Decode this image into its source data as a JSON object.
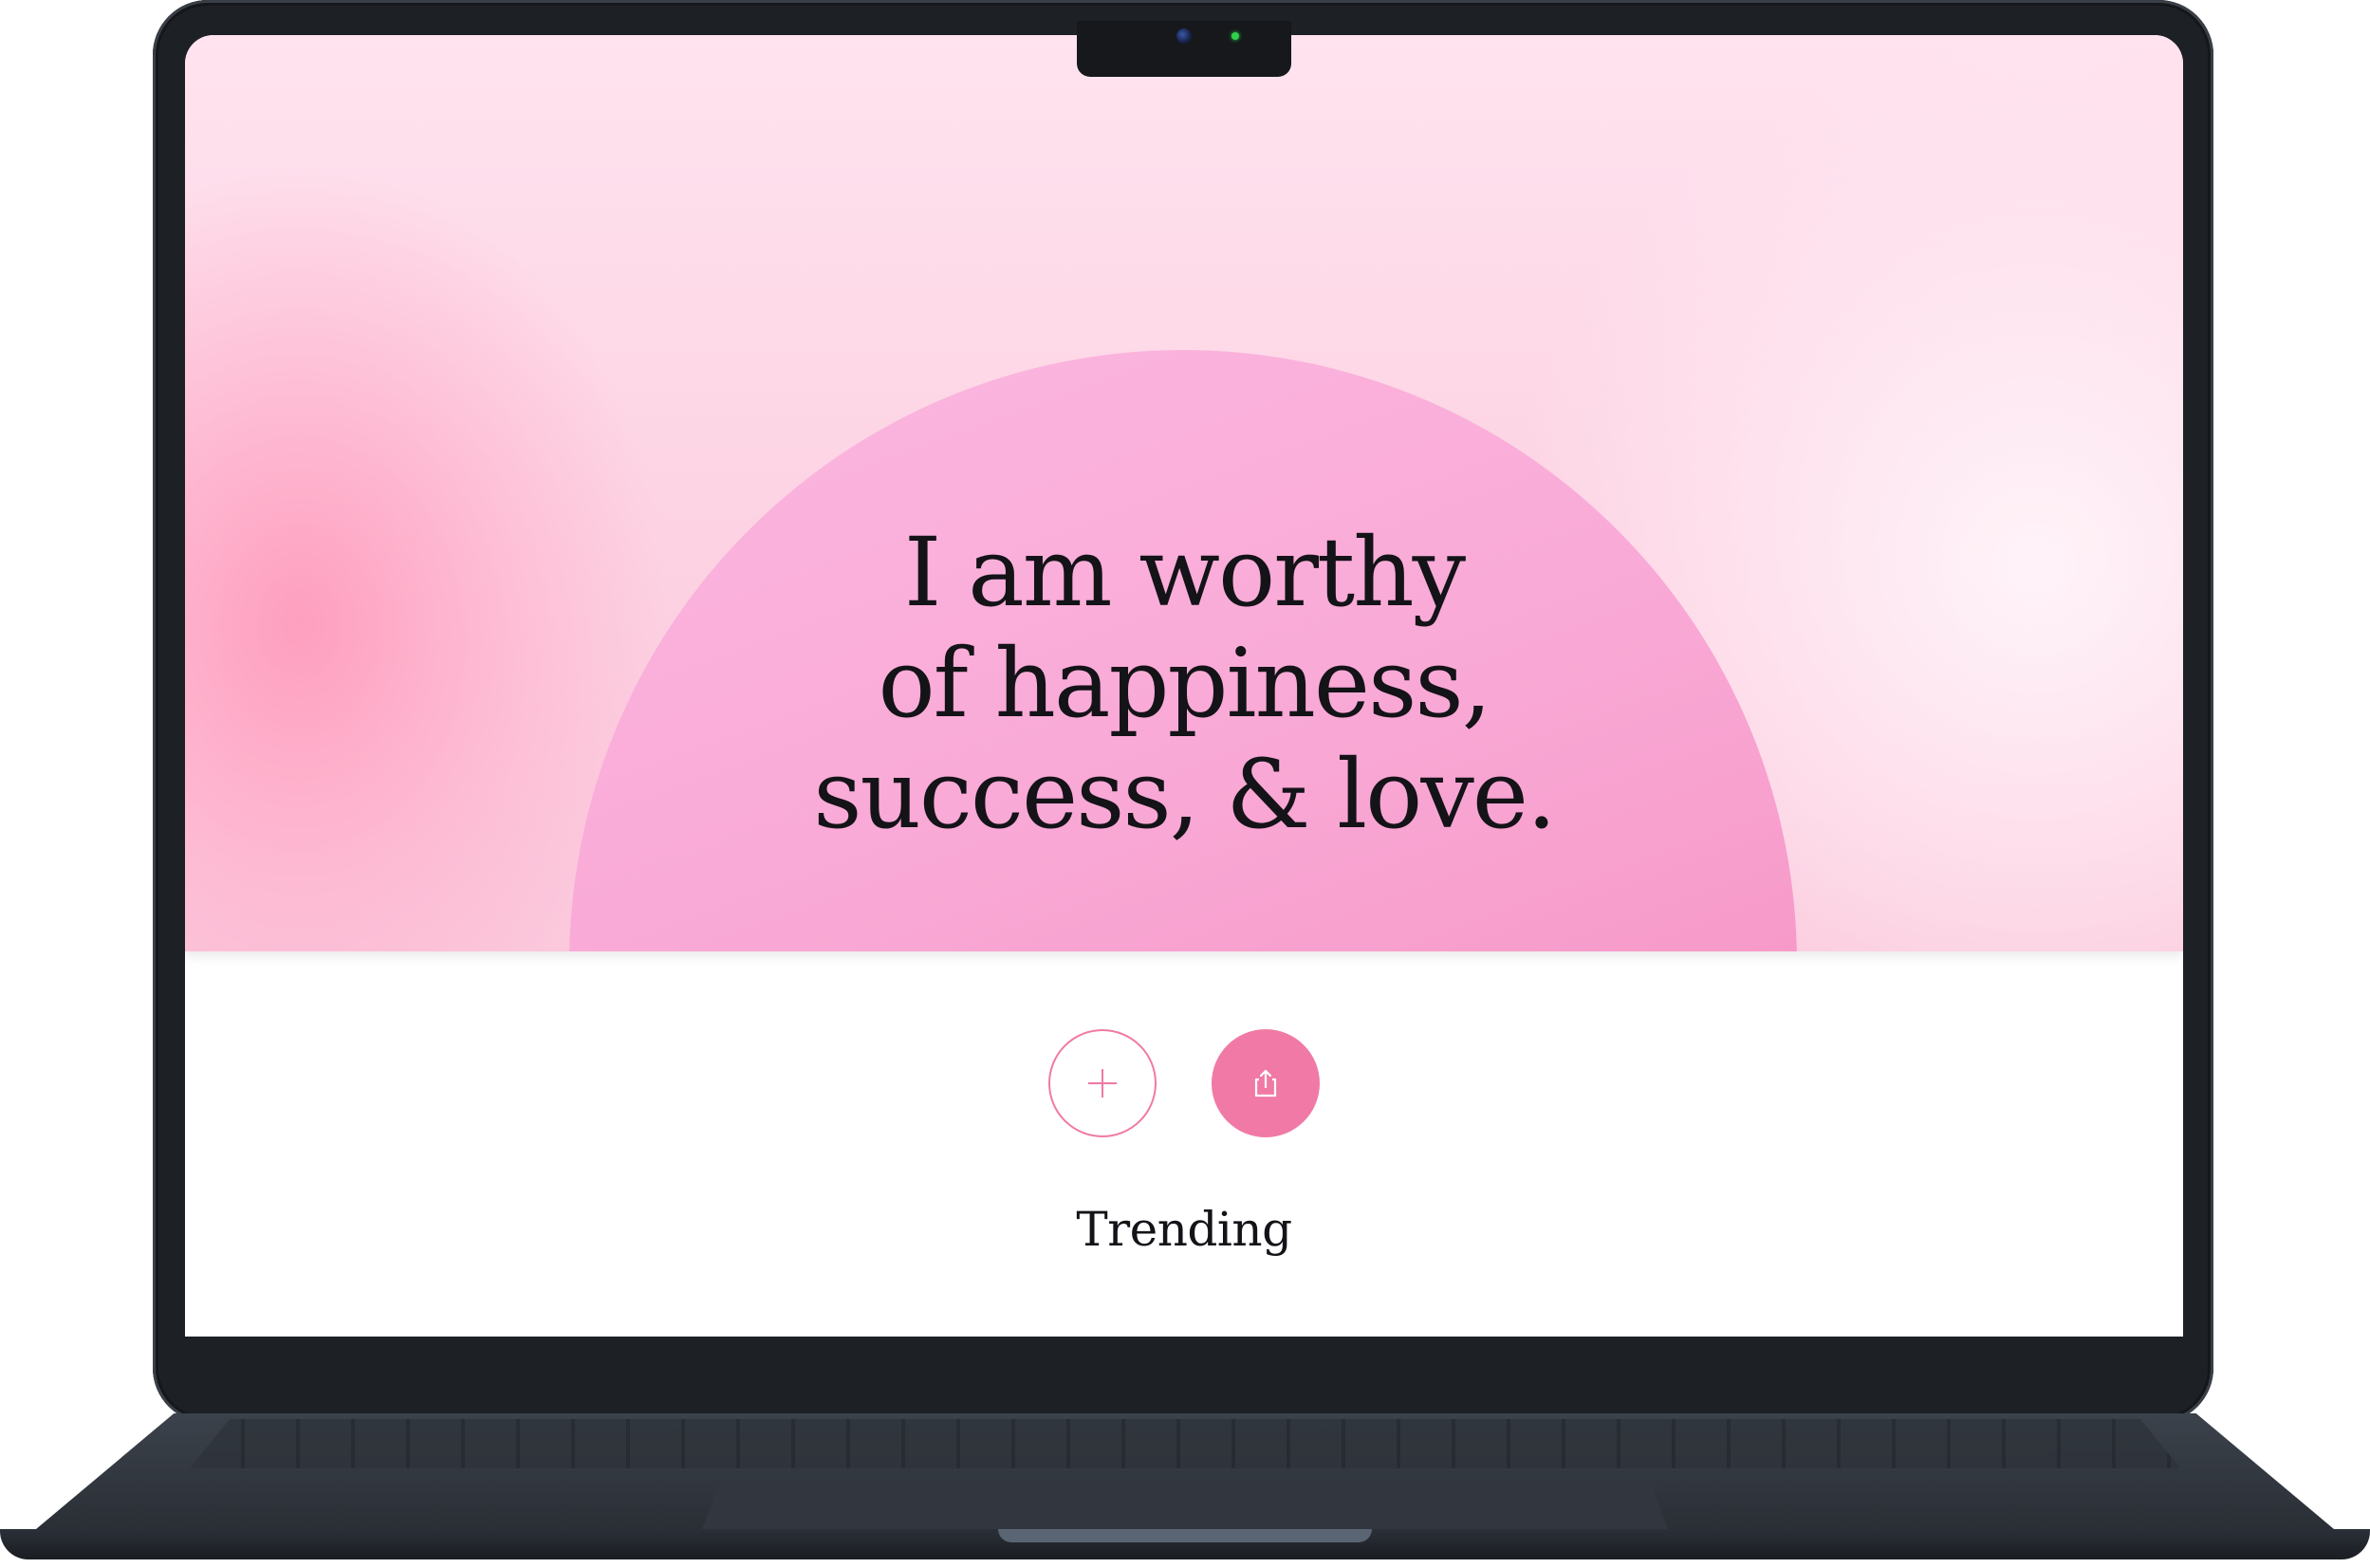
{
  "hero": {
    "affirmation_lines": [
      "I am worthy",
      "of happiness,",
      "success, & love."
    ]
  },
  "actions": {
    "add": {
      "icon": "plus-icon"
    },
    "share": {
      "icon": "share-icon"
    }
  },
  "section": {
    "trending_label": "Trending"
  },
  "colors": {
    "accent": "#f07aa5",
    "text": "#141318",
    "arch": "#f9a8d5",
    "background_top": "#ffe3ef"
  }
}
